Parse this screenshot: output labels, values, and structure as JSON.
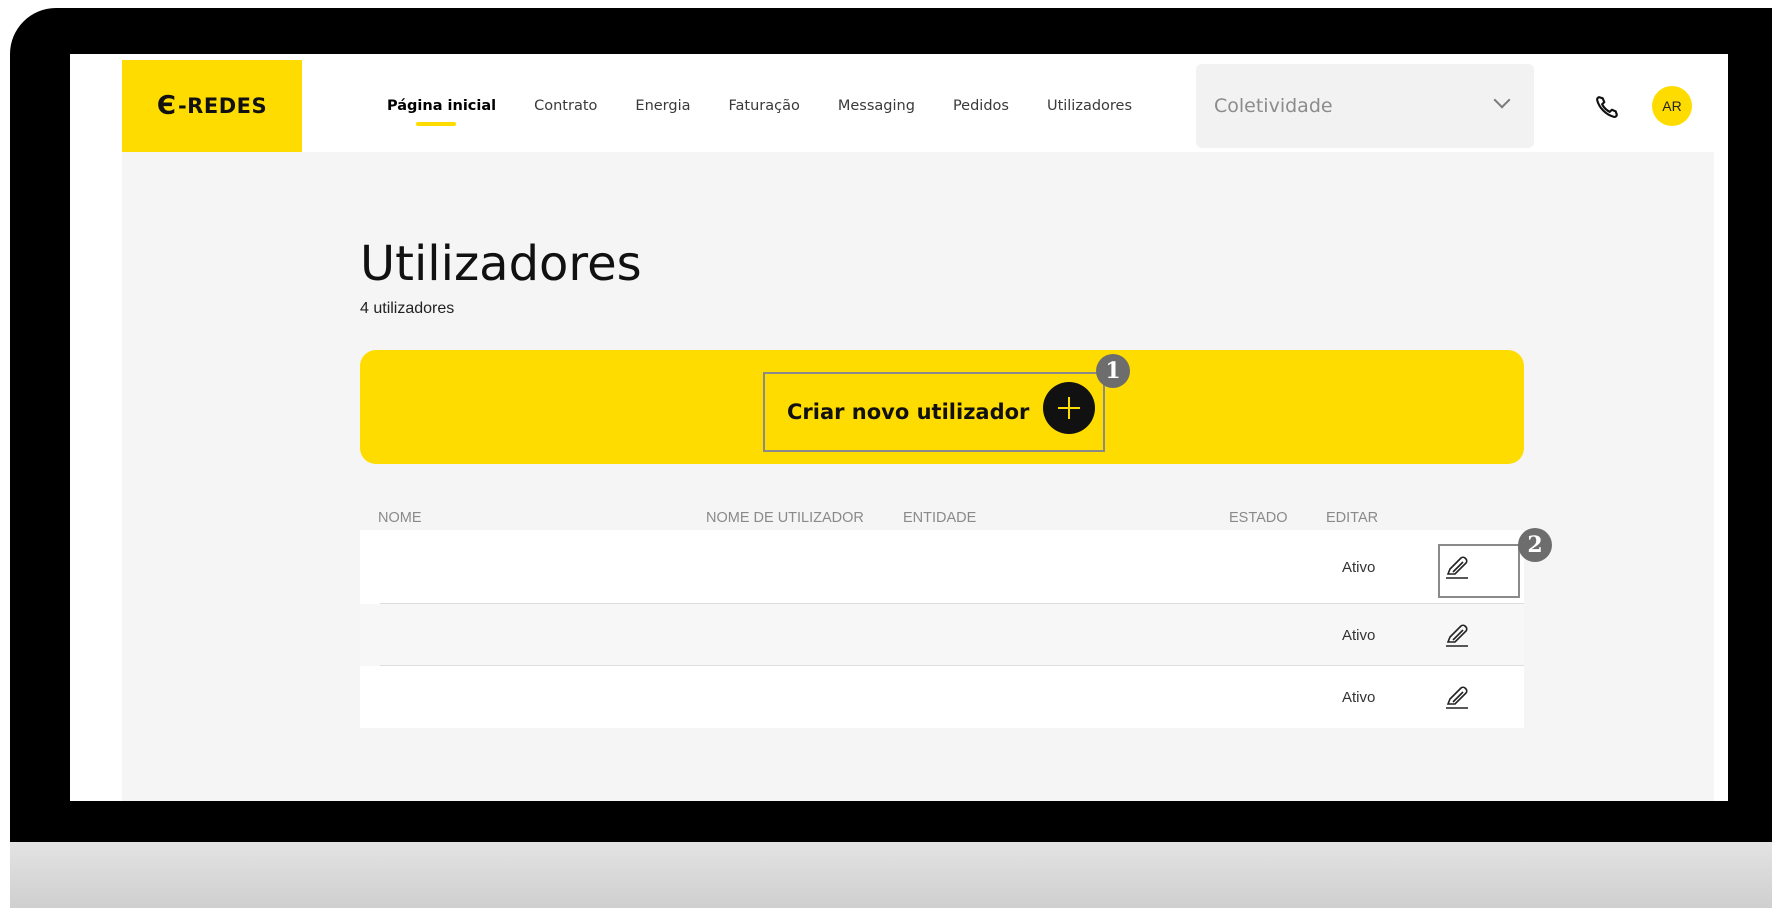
{
  "brand": {
    "logo_mark": "Є",
    "logo_text": "-REDES",
    "accent": "#ffdc00"
  },
  "nav": {
    "items": [
      {
        "label": "Página inicial",
        "active": true
      },
      {
        "label": "Contrato"
      },
      {
        "label": "Energia"
      },
      {
        "label": "Faturação"
      },
      {
        "label": "Messaging"
      },
      {
        "label": "Pedidos"
      },
      {
        "label": "Utilizadores"
      }
    ]
  },
  "collective_select": {
    "value": "Coletividade"
  },
  "user": {
    "initials": "AR"
  },
  "page": {
    "title": "Utilizadores",
    "subtitle": "4 utilizadores"
  },
  "banner": {
    "create_label": "Criar novo utilizador"
  },
  "callouts": {
    "one": "1",
    "two": "2"
  },
  "table": {
    "headers": {
      "name": "NOME",
      "username": "NOME DE UTILIZADOR",
      "entity": "ENTIDADE",
      "status": "ESTADO",
      "edit": "EDITAR"
    },
    "rows": [
      {
        "status": "Ativo"
      },
      {
        "status": "Ativo"
      },
      {
        "status": "Ativo"
      }
    ]
  }
}
